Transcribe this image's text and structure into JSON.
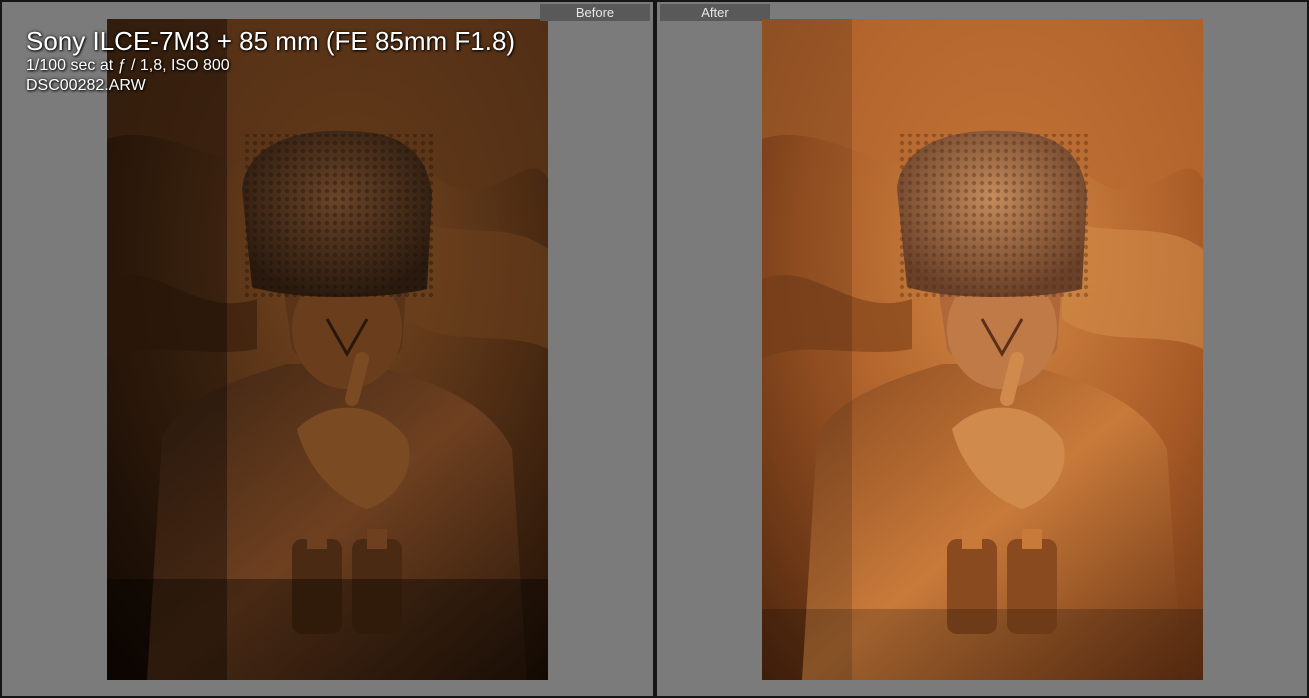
{
  "panes": {
    "before": {
      "label": "Before"
    },
    "after": {
      "label": "After"
    }
  },
  "info_overlay": {
    "camera_lens": "Sony ILCE-7M3 + 85 mm (FE 85mm F1.8)",
    "exposure": "1/100 sec at ƒ / 1,8, ISO 800",
    "filename": "DSC00282.ARW"
  },
  "colors": {
    "background_gray": "#7b7b7b",
    "label_bg": "#595959",
    "divider": "#151515",
    "bronze_before": "#5a3418",
    "bronze_after": "#b5652b"
  }
}
